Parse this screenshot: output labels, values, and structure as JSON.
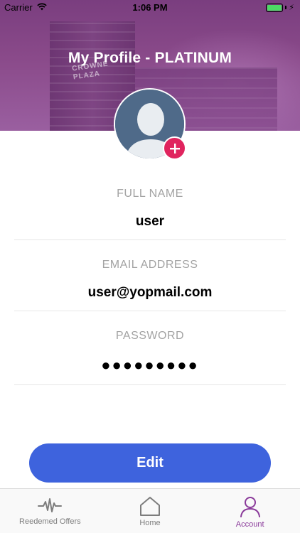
{
  "status_bar": {
    "carrier": "Carrier",
    "time": "1:06 PM"
  },
  "header": {
    "title": "My Profile - PLATINUM",
    "building_sign": "CROWNE\nPLAZA"
  },
  "profile": {
    "full_name_label": "FULL NAME",
    "full_name_value": "user",
    "email_label": "EMAIL ADDRESS",
    "email_value": "user@yopmail.com",
    "password_label": "PASSWORD",
    "password_value": "●●●●●●●●●"
  },
  "actions": {
    "edit_label": "Edit"
  },
  "tab_bar": {
    "tabs": [
      {
        "label": "Reedemed Offers",
        "icon": "pulse-icon",
        "active": false
      },
      {
        "label": "Home",
        "icon": "home-icon",
        "active": false
      },
      {
        "label": "Account",
        "icon": "account-icon",
        "active": true
      }
    ]
  },
  "colors": {
    "header_purple": "#8a4a8a",
    "accent_blue": "#3e63dd",
    "badge_pink": "#e0245e",
    "active_tab": "#8a3a9a"
  }
}
